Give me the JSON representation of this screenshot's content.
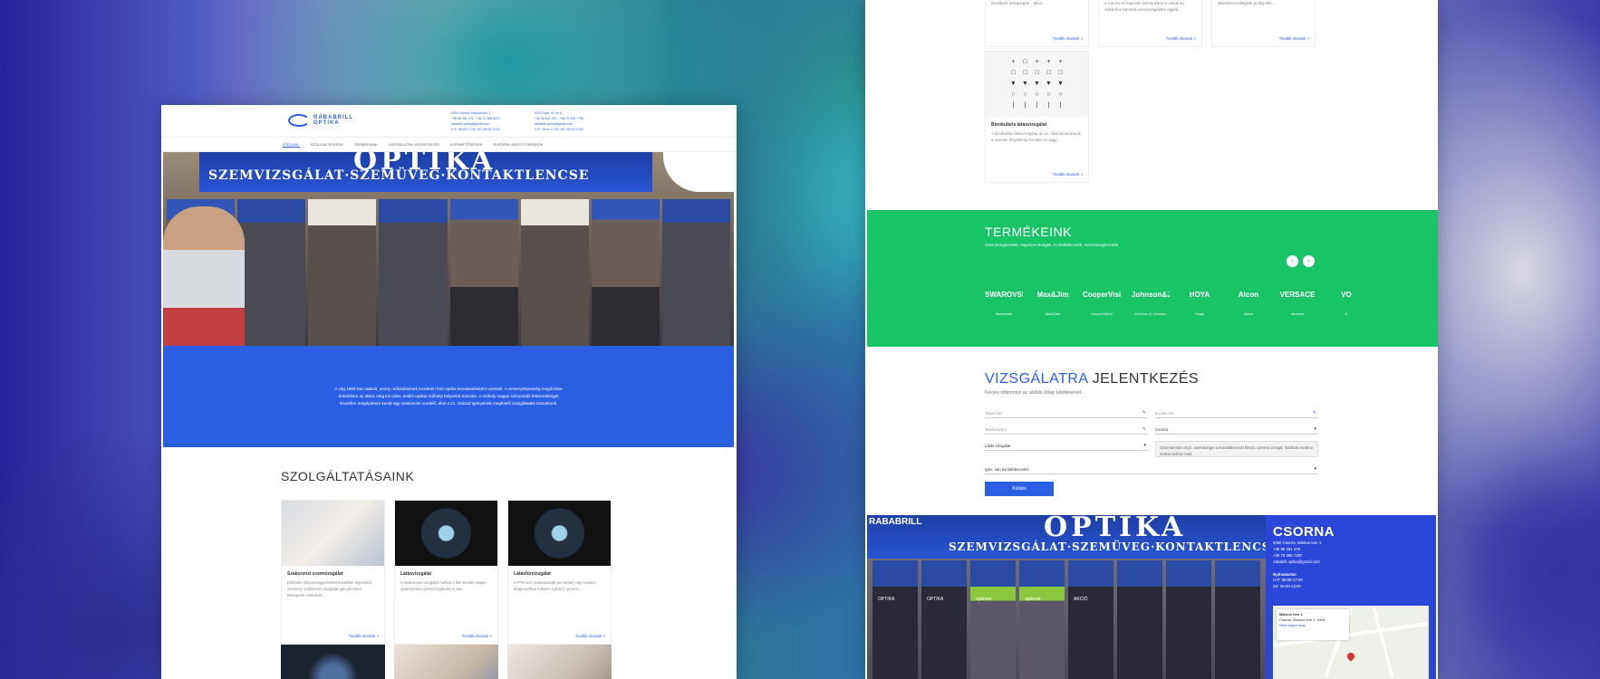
{
  "left": {
    "logo": {
      "line1": "RÁBABRILL",
      "line2": "OPTIKA"
    },
    "contact_col1": [
      "9300 Csorna, Márkus tere 1.",
      "+36 96 261 478 · +36 70 366 5227",
      "rababrill.optika@gmail.com",
      "H-P: 08:00-17:00, SZ: 08:00-12:00"
    ],
    "contact_col2": [
      "9024 Győr, Pl. tér 6.",
      "+36 96 541 000 · +36 70 200 7756",
      "rababrill.optika@gmail.com",
      "H-P: 08:00-17:00, SZ: 08:00-12:00"
    ],
    "nav": [
      "Főoldal",
      "Szolgáltatások",
      "Termékeink",
      "Vizsgálatra jelentkezés",
      "Elérhetőségek",
      "Európai uniós források"
    ],
    "hero": {
      "sign_title": "OPTIKA",
      "sign_sub": "SZEMVIZSGÁLAT·SZEMÜVEG·KONTAKTLENCSE"
    },
    "intro": "A cég 1993-ban alakult, amely működésének kezdetén fotó-optika kereskedésként üzemelt. A versenyképesség megőrzése érdekében az akkor még kis üzlet, önálló optikai műhelyt helyezett üzembe. A műhely magas színvonalú felszereltségét követően megépítésre került egy szakorvosi rendelő, ahol a 21. század igényeinek megfelelő szolgáltatást biztosítunk.",
    "services_title": "SZOLGÁLTATÁSAINK",
    "cards": [
      {
        "title": "Szakorvosi szemvizsgálat",
        "text": "Előzetes időpont egyeztetést követően teljeskörű szemész szakorvosi vizsgálat igénybevétel. Betegeink elvárását...",
        "more": "Tovább olvasok »"
      },
      {
        "title": "Látásvizsgálat",
        "text": "A szakorvosi vizsgálat mellett a felt minden napon optometrista szemvizsgálatra is van...",
        "more": "Tovább olvasok »"
      },
      {
        "title": "Látásfúrvizsgálat",
        "text": "A PTS 910 (automatizált perimeter) egy modern diagnosztikai műszer a precíz, pontos...",
        "more": "Tovább olvasok »"
      }
    ]
  },
  "right": {
    "top_cards": [
      {
        "text": "kezelhető betegségek... Mind...",
        "more": "Tovább olvasok »"
      },
      {
        "text": "a csornai és kapuvári üzletünkben is várjuk kis vidékről a kamerás szemvizsgálatra egyéb...",
        "more": "Tovább olvasok »"
      },
      {
        "text": "látásélesz kollégánk profiig látó...",
        "more": "Tovább olvasok »"
      }
    ],
    "eye_card": {
      "chart": [
        "+",
        "□",
        "+",
        "+",
        "+",
        "□",
        "□",
        "□",
        "□",
        "□",
        "▼",
        "▼",
        "▼",
        "▼",
        "▼",
        "○",
        "○",
        "○",
        "○",
        "○",
        "|",
        "|",
        "|",
        "|",
        "|"
      ],
      "title": "Binokuláris látásvizsgálat",
      "text": "A binokuláris látásvizsgálat az un. okulomotorikusok, a szemek fényitelésa frontális és vagy...",
      "more": "Tovább olvasok »"
    },
    "products": {
      "title": "TERMÉKEINK",
      "subtitle": "Szemüvegkeretek, Napszemüvegek, Kontaktlencsék, Szemüveglencsék",
      "prev": "‹",
      "next": "›",
      "brands": [
        {
          "logo": "SWAROVSKI",
          "name": "Swarovski"
        },
        {
          "logo": "Max&Jim",
          "name": "Max&Jim"
        },
        {
          "logo": "CooperVision",
          "name": "CooperVision"
        },
        {
          "logo": "Johnson&Johnson",
          "name": "Johnson & Johnson"
        },
        {
          "logo": "HOYA",
          "name": "Hoya"
        },
        {
          "logo": "Alcon",
          "name": "Alcon"
        },
        {
          "logo": "VERSACE",
          "name": "Versace"
        },
        {
          "logo": "VO",
          "name": "V"
        }
      ]
    },
    "form": {
      "title_highlight": "VIZSGÁLATRA",
      "title_rest": " JELENTKEZÉS",
      "subtitle": "Kérjen időpontot az alábbi űrlap kitöltésével...",
      "name_placeholder": "Teljes név",
      "email_placeholder": "E-mail cím",
      "phone_placeholder": "Telefonszám",
      "city_value": "Csorna",
      "exam_value": "Látás vizsgálat",
      "note": "Optometrista vágó, szemüveget a kontaktlencsét illeszt, szemet vizsgál, indokolt esetben szakorvoshoz küld.",
      "contact_lens_value": "Igen, van kontaktlencsém",
      "submit": "Küldés"
    },
    "store": {
      "brand": "RABABRILL",
      "sign_title": "OPTIKA",
      "sign_sub": "SZEMVIZSGÁLAT·SZEMÜVEG·KONTAKTLENCSE",
      "col_labels": [
        "OPTIKA",
        "OPTIKA",
        "opticnet",
        "opticnet",
        "AKCIÓ",
        "",
        "",
        ""
      ]
    },
    "info": {
      "title": "CSORNA",
      "lines": [
        "9300 Csorna, Márkus tere 1.",
        "+36 96 261 478",
        "+36 70 366 7287",
        "rababrill.optika@gmail.com"
      ],
      "hours_title": "Nyitvatartás",
      "hours": [
        "H-P: 08:00-17:00",
        "SZ: 08:00-13:00"
      ],
      "map_title": "Márkus tere 1",
      "map_address": "Csorna, Márkus tere 1, 9300",
      "map_link": "View larger map"
    }
  }
}
